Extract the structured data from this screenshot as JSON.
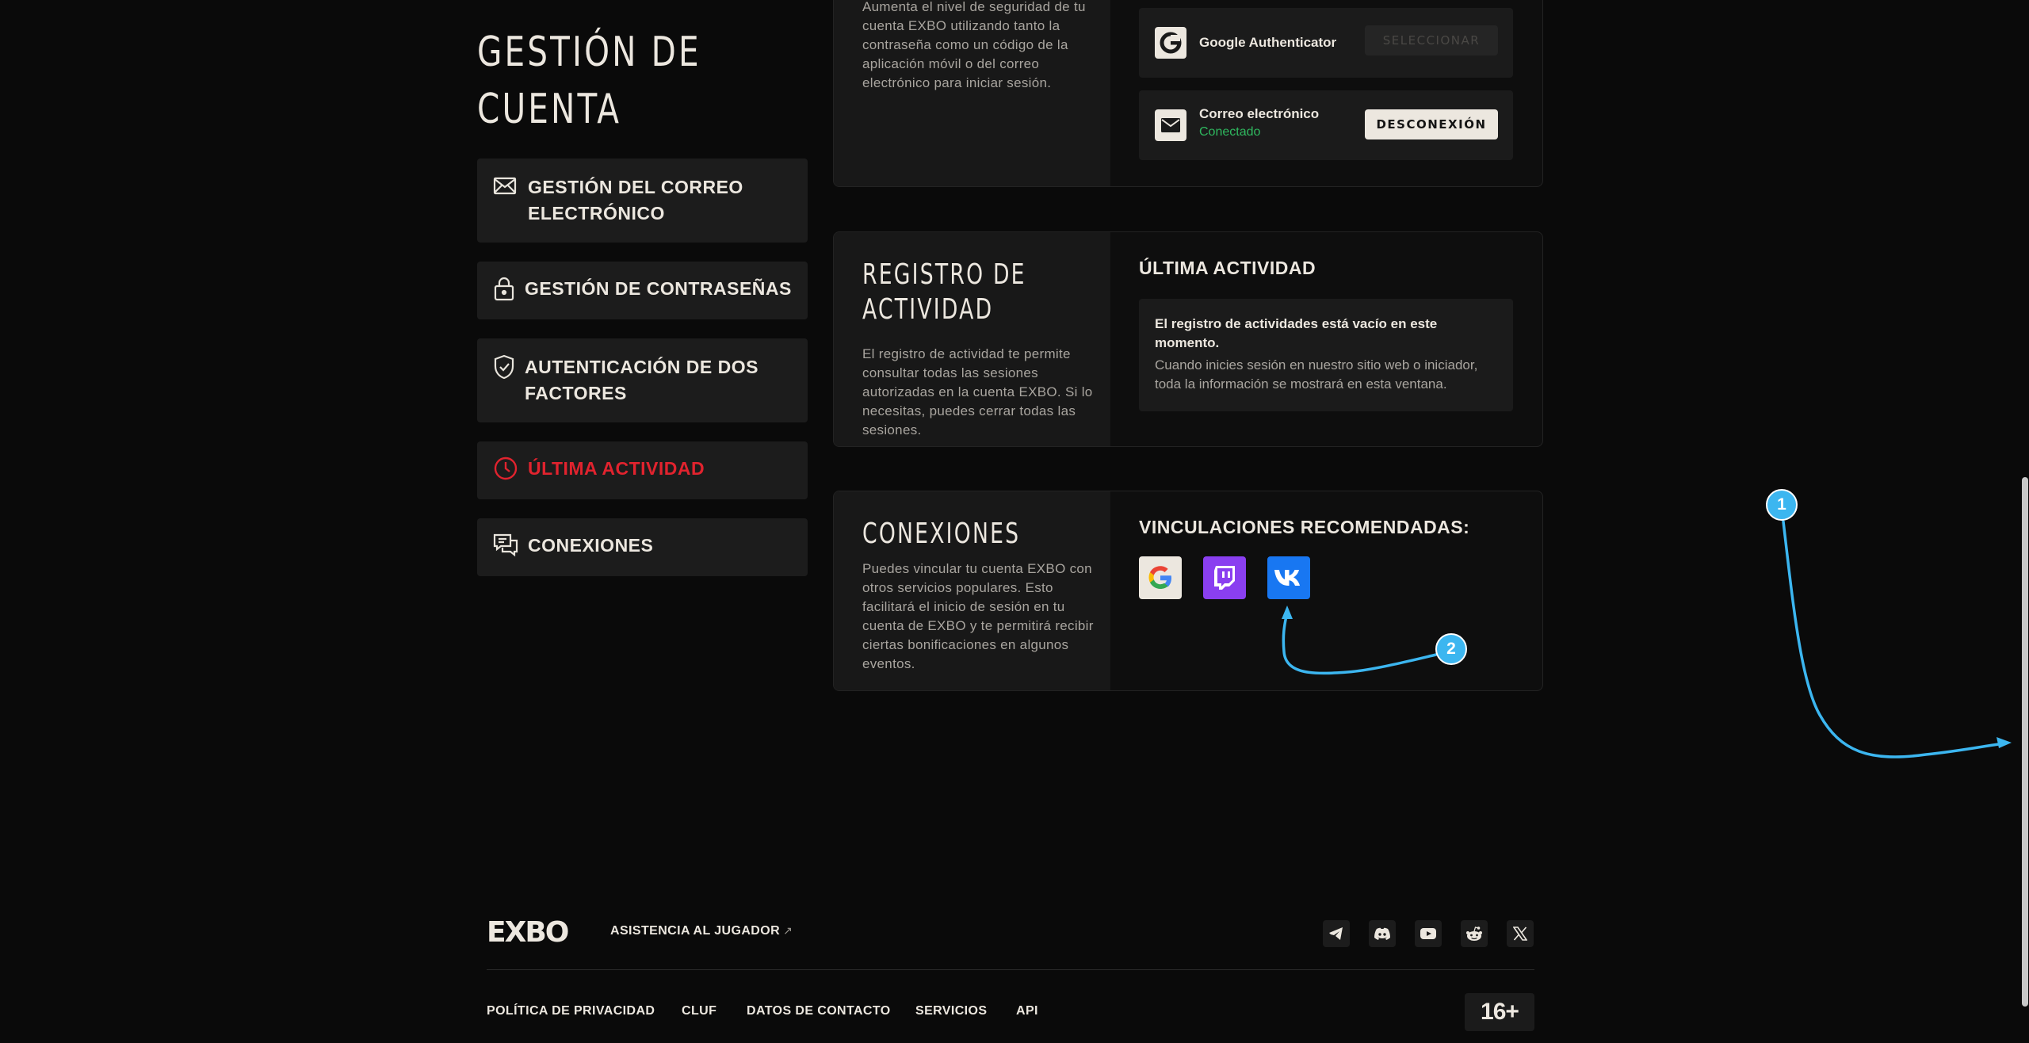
{
  "sidebar": {
    "title": "GESTIÓN DE CUENTA",
    "items": [
      {
        "label": "GESTIÓN DEL CORREO ELECTRÓNICO",
        "icon": "mail-icon"
      },
      {
        "label": "GESTIÓN DE CONTRASEÑAS",
        "icon": "lock-icon"
      },
      {
        "label": "AUTENTICACIÓN DE DOS FACTORES",
        "icon": "shield-check-icon"
      },
      {
        "label": "ÚLTIMA ACTIVIDAD",
        "icon": "clock-icon",
        "active": true
      },
      {
        "label": "CONEXIONES",
        "icon": "chat-icon"
      }
    ]
  },
  "two_factor": {
    "description": "Aumenta el nivel de seguridad de tu cuenta EXBO utilizando tanto la contraseña como un código de la aplicación móvil o del correo electrónico para iniciar sesión.",
    "methods": [
      {
        "name": "Google Authenticator",
        "icon": "google-g-icon",
        "button": "SELECCIONAR",
        "button_state": "disabled"
      },
      {
        "name": "Correo electrónico",
        "status": "Conectado",
        "icon": "envelope-icon",
        "button": "DESCONEXIÓN"
      }
    ]
  },
  "activity": {
    "title": "REGISTRO DE ACTIVIDAD",
    "description": "El registro de actividad te permite consultar todas las sesiones autorizadas en la cuenta EXBO. Si lo necesitas, puedes cerrar todas las sesiones.",
    "heading": "ÚLTIMA ACTIVIDAD",
    "empty_title": "El registro de actividades está vacío en este momento.",
    "empty_text": "Cuando inicies sesión en nuestro sitio web o iniciador, toda la información se mostrará en esta ventana."
  },
  "connections": {
    "title": "CONEXIONES",
    "description": "Puedes vincular tu cuenta EXBO con otros servicios populares. Esto facilitará el inicio de sesión en tu cuenta de EXBO y te permitirá recibir ciertas bonificaciones en algunos eventos.",
    "heading": "VINCULACIONES RECOMENDADAS:",
    "services": [
      {
        "icon": "google-icon",
        "color": "#ece7df"
      },
      {
        "icon": "twitch-icon",
        "color": "#8a3ff0"
      },
      {
        "icon": "vk-icon",
        "color": "#1877f2"
      }
    ]
  },
  "footer": {
    "logo": "EXBO",
    "support": "ASISTENCIA AL JUGADOR",
    "support_arrow": "↗",
    "social": [
      "telegram-icon",
      "discord-icon",
      "youtube-icon",
      "reddit-icon",
      "x-icon"
    ],
    "links": [
      "POLÍTICA DE PRIVACIDAD",
      "CLUF",
      "DATOS DE CONTACTO",
      "SERVICIOS",
      "API"
    ],
    "age": "16+"
  },
  "annotations": {
    "marker_1": "1",
    "marker_2": "2",
    "color": "#3cb6f0"
  }
}
